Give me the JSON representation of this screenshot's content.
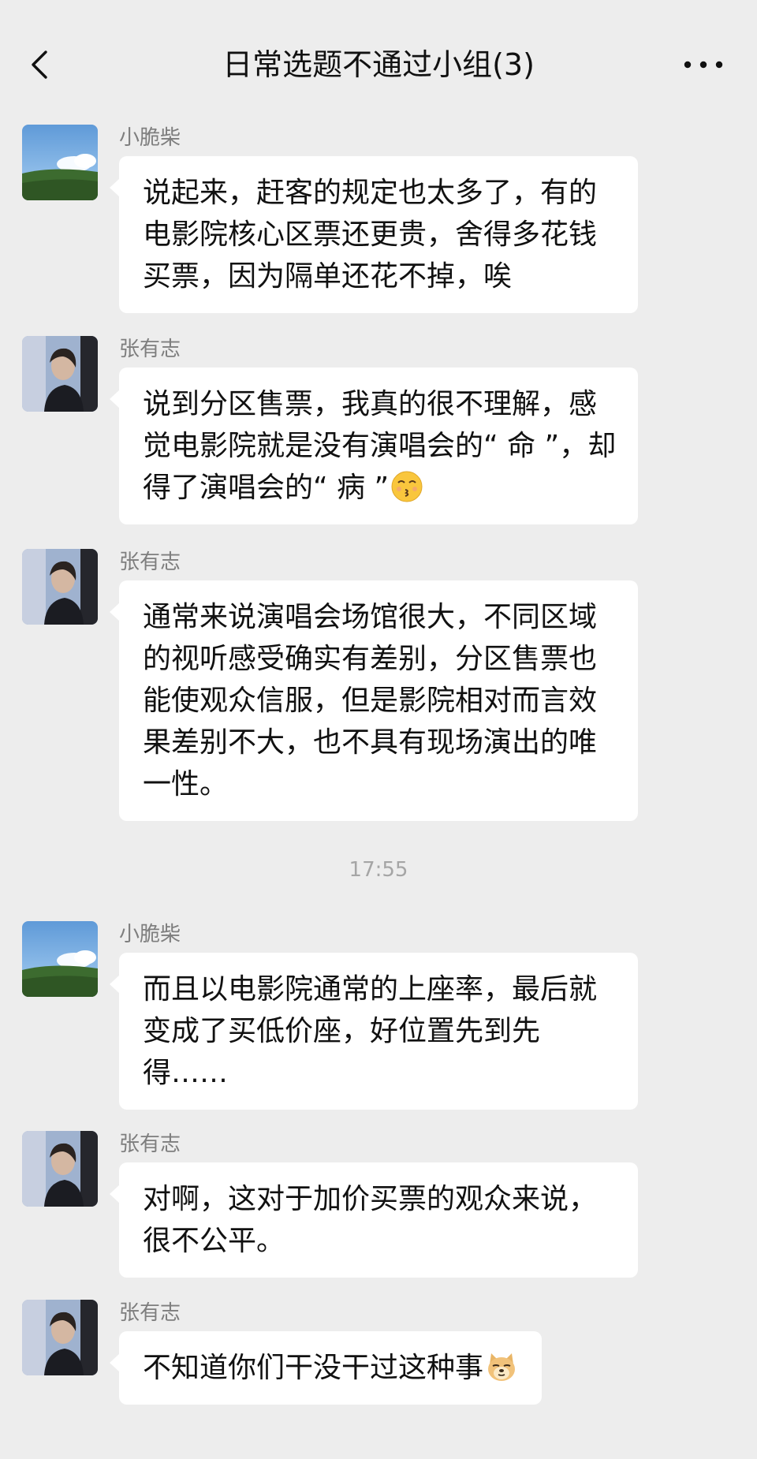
{
  "header": {
    "title": "日常选题不通过小组(3)",
    "back_icon": "chevron-left-icon",
    "more_icon": "more-dots-icon"
  },
  "timestamp": "17:55",
  "messages": [
    {
      "sender": "小脆柴",
      "avatar": "landscape-avatar",
      "text": "说起来，赶客的规定也太多了，有的电影院核心区票还更贵，舍得多花钱买票，因为隔单还花不掉，唉",
      "emoji": ""
    },
    {
      "sender": "张有志",
      "avatar": "portrait-avatar",
      "text": "说到分区售票，我真的很不理解，感觉电影院就是没有演唱会的“ 命 ”，却得了演唱会的“ 病 ”",
      "emoji": "kissing-closed-eyes-emoji"
    },
    {
      "sender": "张有志",
      "avatar": "portrait-avatar",
      "text": "通常来说演唱会场馆很大，不同区域的视听感受确实有差别，分区售票也能使观众信服，但是影院相对而言效果差别不大，也不具有现场演出的唯一性。",
      "emoji": ""
    },
    {
      "sender": "小脆柴",
      "avatar": "landscape-avatar",
      "text": "而且以电影院通常的上座率，最后就变成了买低价座，好位置先到先得……",
      "emoji": ""
    },
    {
      "sender": "张有志",
      "avatar": "portrait-avatar",
      "text": "对啊，这对于加价买票的观众来说，很不公平。",
      "emoji": ""
    },
    {
      "sender": "张有志",
      "avatar": "portrait-avatar",
      "text": "不知道你们干没干过这种事",
      "emoji": "doge-emoji"
    }
  ],
  "colors": {
    "background": "#ededed",
    "bubble": "#ffffff",
    "sender_name": "#7e7e7e",
    "timestamp": "#a5a5a5"
  }
}
